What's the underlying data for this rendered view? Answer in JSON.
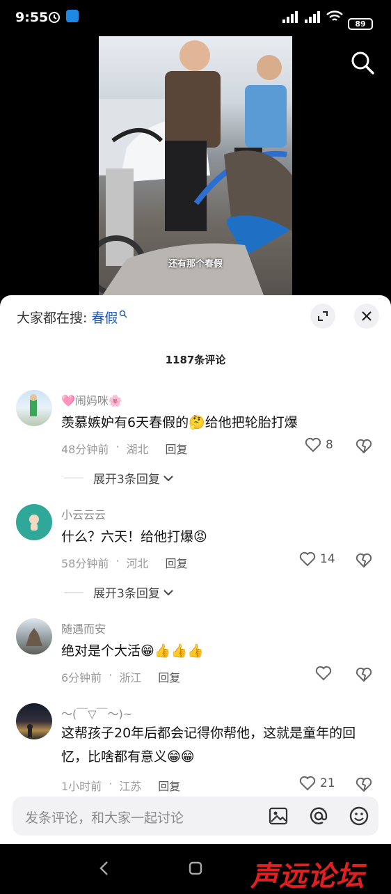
{
  "status_bar": {
    "time": "9:55",
    "battery": "89"
  },
  "video": {
    "caption": "还有那个春假"
  },
  "sheet": {
    "search_prefix": "大家都在搜:",
    "search_keyword": "春假",
    "comment_count": "1187条评论"
  },
  "comments": [
    {
      "name": "🩷闹妈咪🌸",
      "text": "羡慕嫉妒有6天春假的🤔给他把轮胎打爆",
      "time": "48分钟前",
      "location": "湖北",
      "reply": "回复",
      "likes": "8",
      "expand": "展开3条回复"
    },
    {
      "name": "小云云云",
      "text": "什么？六天！给他打爆😡",
      "time": "58分钟前",
      "location": "河北",
      "reply": "回复",
      "likes": "14",
      "expand": "展开3条回复"
    },
    {
      "name": "随遇而安",
      "text": "绝对是个大活😁👍👍👍",
      "time": "6分钟前",
      "location": "浙江",
      "reply": "回复",
      "likes": ""
    },
    {
      "name": "～(￣▽￣～)~",
      "text": "这帮孩子20年后都会记得你帮他，这就是童年的回忆，比啥都有意义😁😁",
      "time": "1小时前",
      "location": "江苏",
      "reply": "回复",
      "likes": "21"
    }
  ],
  "input": {
    "placeholder": "发条评论，和大家一起讨论"
  },
  "watermark": "声远论坛"
}
